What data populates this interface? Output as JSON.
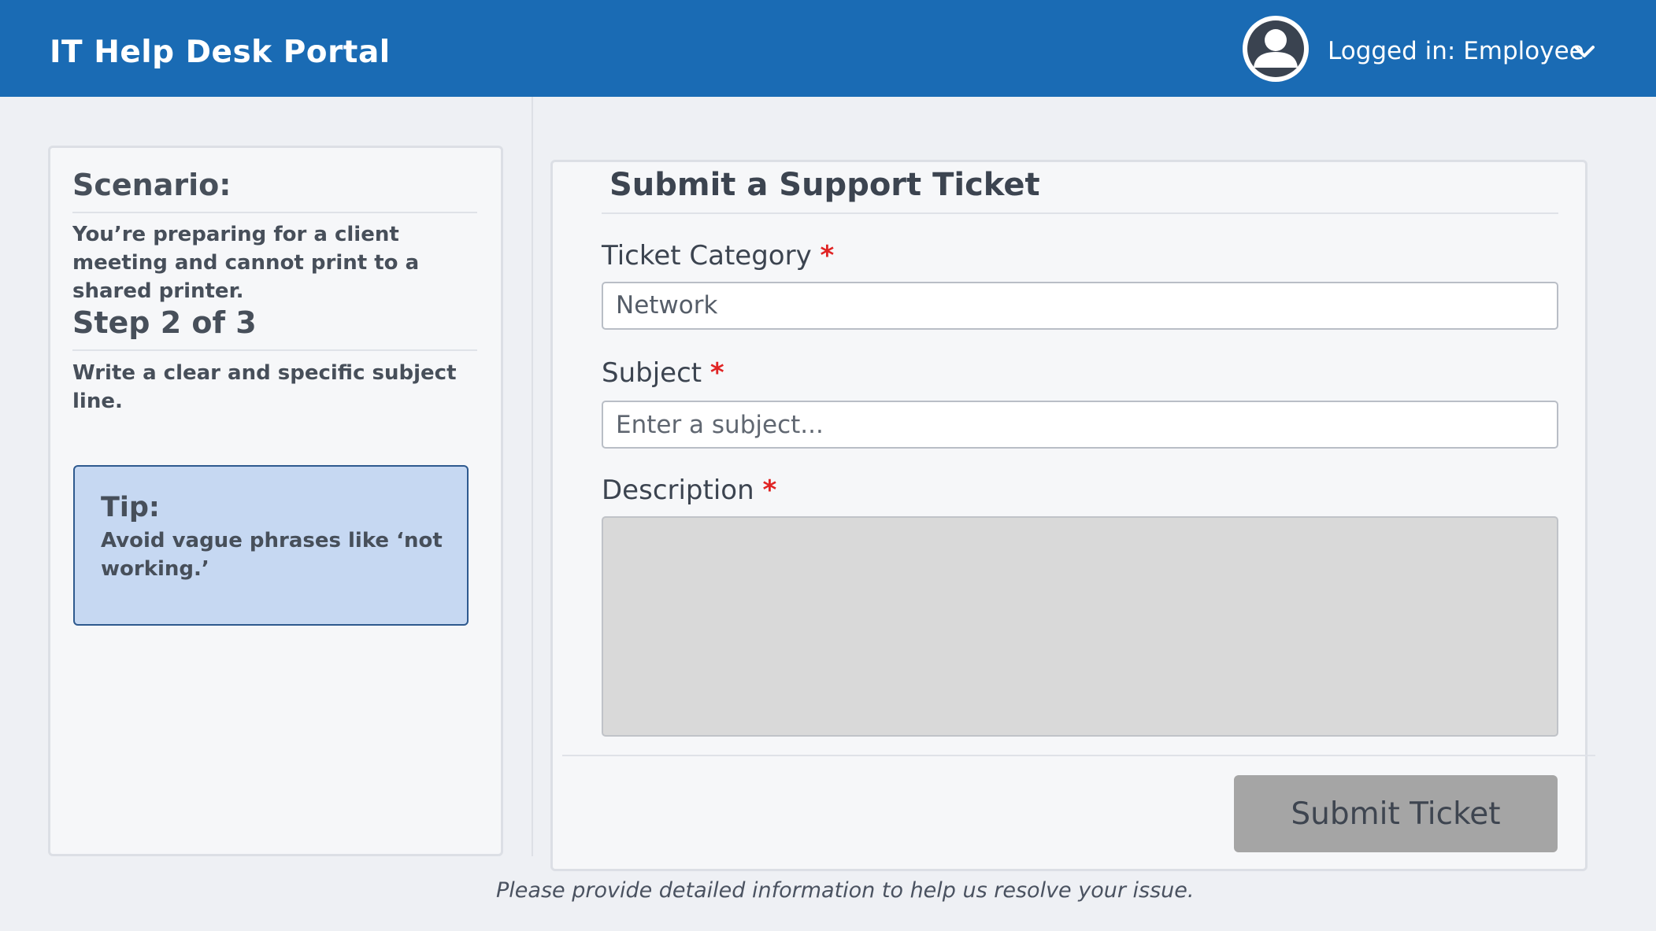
{
  "header": {
    "app_title": "IT Help Desk Portal",
    "user_label": "Logged in: Employee",
    "avatar_icon": "user-avatar-icon",
    "dropdown_icon": "chevron-down-icon",
    "background_color": "#1a6bb4"
  },
  "sidebar": {
    "scenario_heading": "Scenario:",
    "scenario_text": "You’re preparing for a client meeting and cannot print to a shared printer.",
    "step_heading": "Step 2 of 3",
    "step_text": "Write a clear and specific subject line.",
    "tip": {
      "title": "Tip:",
      "text": "Avoid vague phrases like ‘not working.’",
      "background_color": "#c6d8f2"
    }
  },
  "form": {
    "title": "Submit a Support Ticket",
    "required_marker": "*",
    "category": {
      "label": "Ticket Category",
      "value": "Network"
    },
    "subject": {
      "label": "Subject",
      "value": "",
      "placeholder": "Enter a subject..."
    },
    "description": {
      "label": "Description",
      "value": ""
    },
    "submit_label": "Submit Ticket",
    "submit_state": "disabled"
  },
  "footer": {
    "note": "Please provide detailed information to help us resolve your issue."
  },
  "colors": {
    "required": "#e02424",
    "submit_button": "#a5a5a5"
  }
}
